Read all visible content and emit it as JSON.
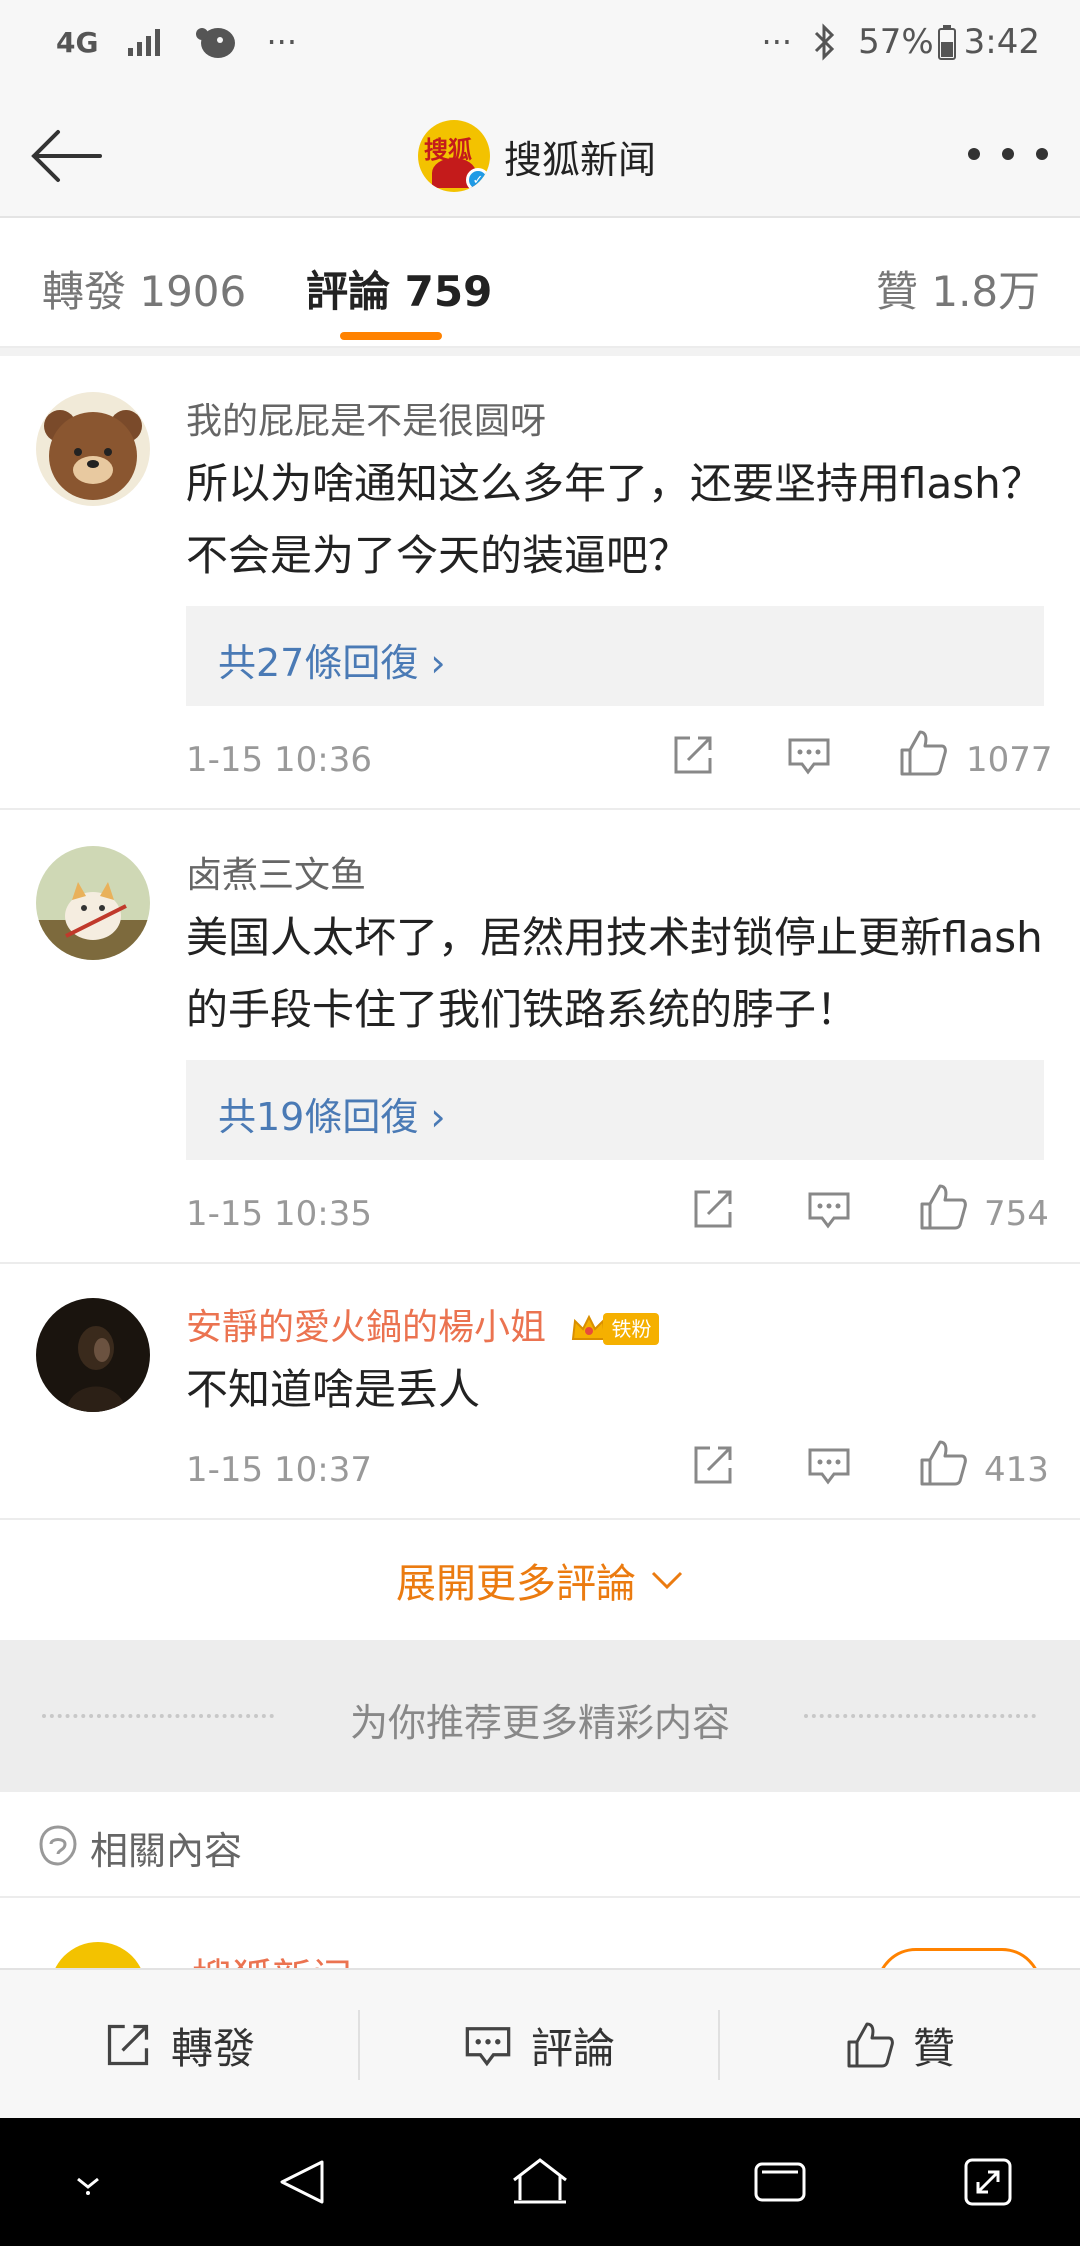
{
  "status_bar": {
    "network": "4G",
    "overflow_left": "···",
    "overflow_right": "···",
    "battery": "57%",
    "time": "3:42"
  },
  "nav": {
    "title": "搜狐新闻",
    "logo_text": "搜狐",
    "verified_mark": "✓"
  },
  "tabs": {
    "repost": "轉發 1906",
    "comments": "評論 759",
    "likes": "贊 1.8万"
  },
  "comments": [
    {
      "name": "我的屁屁是不是很圆呀",
      "text": "所以为啥通知这么多年了，还要坚持用flash？ 不会是为了今天的装逼吧？",
      "replies": "共27條回復 ›",
      "time": "1-15 10:36",
      "likes": "1077"
    },
    {
      "name": "卤煮三文鱼",
      "text": "美国人太坏了，居然用技术封锁停止更新flash的手段卡住了我们铁路系统的脖子！",
      "replies": "共19條回復 ›",
      "time": "1-15 10:35",
      "likes": "754"
    },
    {
      "name": "安靜的愛火鍋的楊小姐",
      "badge": "铁粉",
      "text": "不知道啥是丢人",
      "time": "1-15 10:37",
      "likes": "413"
    }
  ],
  "expand_more": "展開更多評論",
  "recommend": "为你推荐更多精彩内容",
  "related": "相關內容",
  "peek_name": "搜狐新闻",
  "bottom_bar": {
    "repost": "轉發",
    "comment": "評論",
    "like": "贊"
  },
  "colors": {
    "accent_orange": "#ff8200",
    "link_blue": "#4a7ab5",
    "vip_name": "#eb7350"
  }
}
